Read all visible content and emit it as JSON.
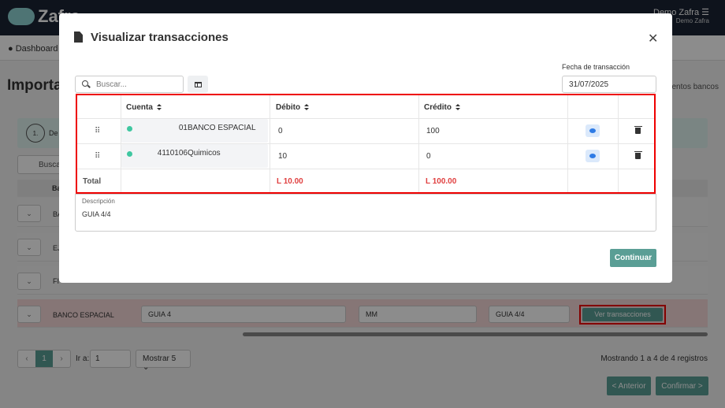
{
  "app": {
    "brand": "Zafra",
    "user_name": "Demo Zafra",
    "user_company": "Demo Zafra",
    "breadcrumb": "Dashboard",
    "page_title": "Importa",
    "right_link": "entos bancos",
    "step_number": "1.",
    "step_text": "De",
    "search_placeholder": "Busca",
    "column_header": "Ba",
    "rows": [
      {
        "bank": "BA",
        "description": "",
        "ref": "",
        "ref2": ""
      },
      {
        "bank": "EJ",
        "description": "",
        "ref": "",
        "ref2": ""
      },
      {
        "bank": "FI",
        "description": "",
        "ref": "",
        "ref2": ""
      },
      {
        "bank": "BANCO ESPACIAL",
        "description": "GUIA 4",
        "ref": "MM",
        "ref2": "GUIA 4/4"
      }
    ],
    "ver_transacciones": "Ver transacciones",
    "pager_current": "1",
    "goto_label": "Ir a:",
    "goto_value": "1",
    "page_size": "Mostrar 5",
    "showing": "Mostrando 1 a 4 de 4 registros",
    "prev_label": "< Anterior",
    "confirm_label": "Confirmar >"
  },
  "modal": {
    "title": "Visualizar transacciones",
    "search_placeholder": "Buscar...",
    "fecha_label": "Fecha de transacción",
    "fecha_value": "31/07/2025",
    "headers": {
      "cuenta": "Cuenta",
      "debito": "Débito",
      "credito": "Crédito"
    },
    "entries": [
      {
        "code": "01",
        "name": "BANCO ESPACIAL",
        "debito": "0",
        "credito": "100"
      },
      {
        "code": "4110106",
        "name": "Quimicos",
        "debito": "10",
        "credito": "0"
      }
    ],
    "total_label": "Total",
    "total_debito": "L 10.00",
    "total_credito": "L 100.00",
    "desc_label": "Descripción",
    "desc_value": "GUIA 4/4",
    "continue_label": "Continuar"
  }
}
